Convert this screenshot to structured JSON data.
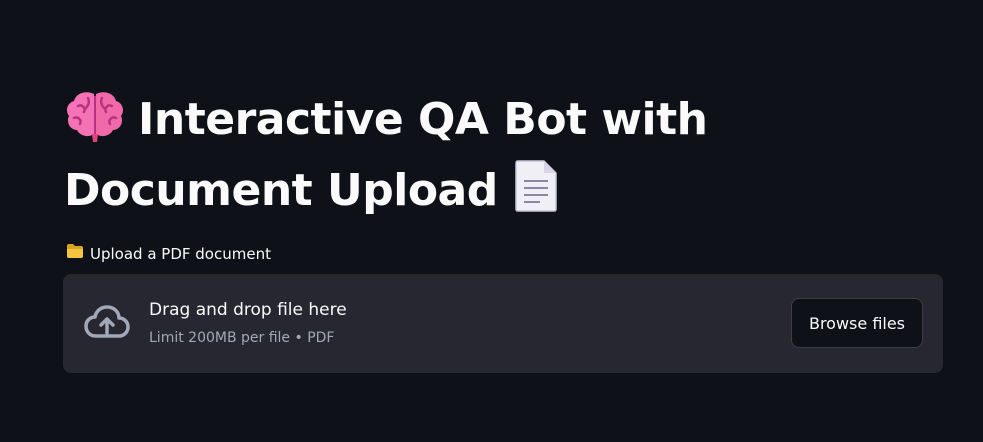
{
  "header": {
    "title_line1": "Interactive QA Bot with",
    "title_line2": "Document Upload",
    "title_icon_left": "brain-icon",
    "title_icon_right": "document-icon"
  },
  "uploader": {
    "label": "Upload a PDF document",
    "label_icon": "folder-icon",
    "drop_text": "Drag and drop file here",
    "limit_text": "Limit 200MB per file • PDF",
    "browse_label": "Browse files",
    "drop_icon": "cloud-upload-icon"
  },
  "colors": {
    "background": "#0e1117",
    "dropzone": "#262730",
    "text": "#fafafa",
    "muted_text": "#a3a8b8",
    "brain": "#f472b6",
    "folder": "#f5c542"
  }
}
